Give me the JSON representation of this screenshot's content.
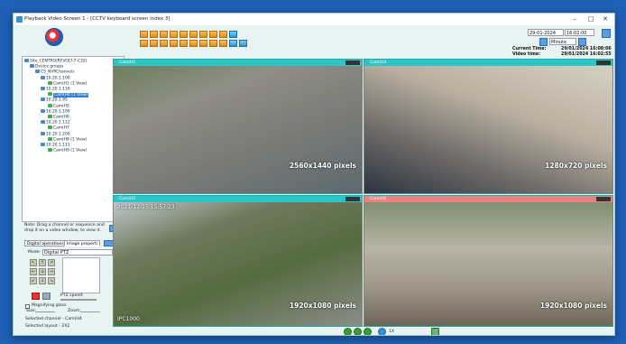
{
  "window": {
    "title": "Playback Video Screen 1 - [CCTV keyboard screen index 3]",
    "minimize": "–",
    "maximize": "□",
    "close": "✕"
  },
  "toolbar": {
    "date": "29-01-2024",
    "time": "16:02:00",
    "step_unit": "Minute",
    "current_time_label": "Current Time:",
    "current_time_value": "29/01/2024 16:08:06",
    "video_time_label": "Video time:",
    "video_time_value": "29/01/2024 16:02:55"
  },
  "tree": {
    "items": [
      {
        "label": "Site_CENTRO(REVOLT-7-C32)",
        "type": "site"
      },
      {
        "label": "Device groups",
        "type": "group"
      },
      {
        "label": "CS_NVRChannels",
        "type": "group"
      },
      {
        "label": "10.20.1.100",
        "type": "device"
      },
      {
        "label": "Cam(H1 (1 View)",
        "type": "camera"
      },
      {
        "label": "10.20.1.110",
        "type": "device"
      },
      {
        "label": "Cam(H4 (1 View)",
        "type": "camera",
        "selected": true
      },
      {
        "label": "10.20.1.95",
        "type": "device"
      },
      {
        "label": "Cam(H5",
        "type": "camera"
      },
      {
        "label": "10.20.1.100",
        "type": "device"
      },
      {
        "label": "Cam(H6",
        "type": "camera"
      },
      {
        "label": "10.20.1.112",
        "type": "device"
      },
      {
        "label": "Cam(H7",
        "type": "camera"
      },
      {
        "label": "10.20.1.200",
        "type": "device"
      },
      {
        "label": "Cam(H8 (1 View)",
        "type": "camera"
      },
      {
        "label": "10.20.1.111",
        "type": "device"
      },
      {
        "label": "Cam(H9 (1 View)",
        "type": "camera"
      }
    ]
  },
  "panel": {
    "note": "Note: Drag a channel or sequence and drop it on a video window, to view it.",
    "tab_digital": "Digital operations",
    "tab_image": "Image properti",
    "mode_label": "Mode:",
    "mode_value": "Digital PTZ",
    "ptz_speed": "PTZ speed:",
    "magnifying": "Magnifying glass",
    "size_label": "Size:",
    "zoom_label": "Zoom:",
    "selected_channel": "Selected channel - Cam(H4",
    "selected_layout": "Selected layout - 2X2"
  },
  "videos": [
    {
      "name": "Cam(H1",
      "resolution": "2560x1440 pixels",
      "header_color": "#2cc6c6"
    },
    {
      "name": "Cam(H4",
      "resolution": "1280x720 pixels",
      "header_color": "#2cc6c6"
    },
    {
      "name": "Cam(H5",
      "resolution": "1920x1080 pixels",
      "header_color": "#2cc6c6",
      "overlay": "2021-12-15 15:57:23",
      "overlay2": "IPC1000"
    },
    {
      "name": "Cam(H6",
      "resolution": "1920x1080 pixels",
      "header_color": "#f07f7f"
    }
  ],
  "bottom": {
    "speed": "1X"
  }
}
